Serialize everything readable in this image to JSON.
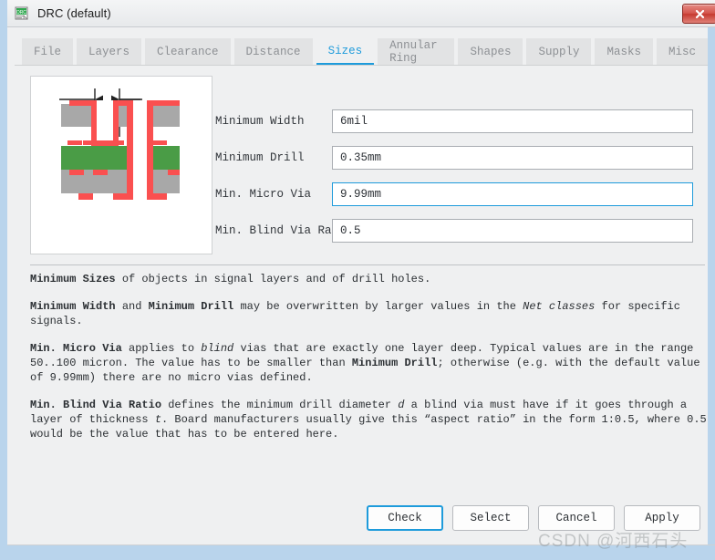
{
  "window": {
    "title": "DRC (default)",
    "icon": "drc-document-icon",
    "close_label": "x",
    "accent_color": "#1e9bdb",
    "border_color": "#b9d4ec"
  },
  "tabs": [
    {
      "label": "File",
      "active": false
    },
    {
      "label": "Layers",
      "active": false
    },
    {
      "label": "Clearance",
      "active": false
    },
    {
      "label": "Distance",
      "active": false
    },
    {
      "label": "Sizes",
      "active": true
    },
    {
      "label": "Annular Ring",
      "active": false
    },
    {
      "label": "Shapes",
      "active": false
    },
    {
      "label": "Supply",
      "active": false
    },
    {
      "label": "Masks",
      "active": false
    },
    {
      "label": "Misc",
      "active": false
    }
  ],
  "illustration": {
    "name": "pcb-cross-section-diagram",
    "copper_color": "#fa5050",
    "substrate_color": "#a8a8a8",
    "core_color": "#4a9c46",
    "leader_color": "#222222"
  },
  "form": {
    "fields": [
      {
        "label": "Minimum Width",
        "value": "6mil",
        "focused": false,
        "name": "minimum-width"
      },
      {
        "label": "Minimum Drill",
        "value": "0.35mm",
        "focused": false,
        "name": "minimum-drill"
      },
      {
        "label": "Min. Micro Via",
        "value": "9.99mm",
        "focused": true,
        "name": "min-micro-via"
      },
      {
        "label": "Min. Blind Via Ratio",
        "value": "0.5",
        "focused": false,
        "name": "min-blind-via-ratio"
      }
    ]
  },
  "description": {
    "paragraphs": [
      "Minimum Sizes of objects in signal layers and of drill holes.",
      "Minimum Width and Minimum Drill may be overwritten by larger values in the Net classes for specific signals.",
      "Min. Micro Via applies to blind vias that are exactly one layer deep. Typical values are in the range 50..100 micron. The value has to be smaller than Minimum Drill; otherwise (e.g. with the default value of 9.99mm) there are no micro vias defined.",
      "Min. Blind Via Ratio defines the minimum drill diameter d a blind via must have if it goes through a layer of thickness t. Board manufacturers usually give this “aspect ratio” in the form 1:0.5, where 0.5 would be the value that has to be entered here."
    ],
    "p1": {
      "bold1": "Minimum Sizes",
      "rest": " of objects in signal layers and of drill holes."
    },
    "p2": {
      "bold1": "Minimum Width",
      "mid": " and ",
      "bold2": "Minimum Drill",
      "rest1": " may be overwritten by larger values in the ",
      "ital": "Net classes",
      "rest2": " for specific signals."
    },
    "p3": {
      "bold1": "Min. Micro Via",
      "rest1": " applies to ",
      "ital": "blind",
      "rest2": " vias that are exactly one layer deep. Typical values are in the range 50..100 micron. The value has to be smaller than ",
      "bold2": "Minimum Drill",
      "rest3": "; otherwise (e.g. with the default value of 9.99mm) there are no micro vias defined."
    },
    "p4": {
      "bold1": "Min. Blind Via Ratio",
      "rest1": " defines the minimum drill diameter ",
      "ital1": "d",
      "rest2": " a blind via must have if it goes through a layer of thickness ",
      "ital2": "t",
      "rest3": ". Board manufacturers usually give this “aspect ratio” in the form 1:0.5, where 0.5 would be the value that has to be entered here."
    }
  },
  "buttons": [
    {
      "label": "Check",
      "default": true,
      "name": "check-button"
    },
    {
      "label": "Select",
      "default": false,
      "name": "select-button"
    },
    {
      "label": "Cancel",
      "default": false,
      "name": "cancel-button"
    },
    {
      "label": "Apply",
      "default": false,
      "name": "apply-button"
    }
  ],
  "watermark": "CSDN @河西石头"
}
